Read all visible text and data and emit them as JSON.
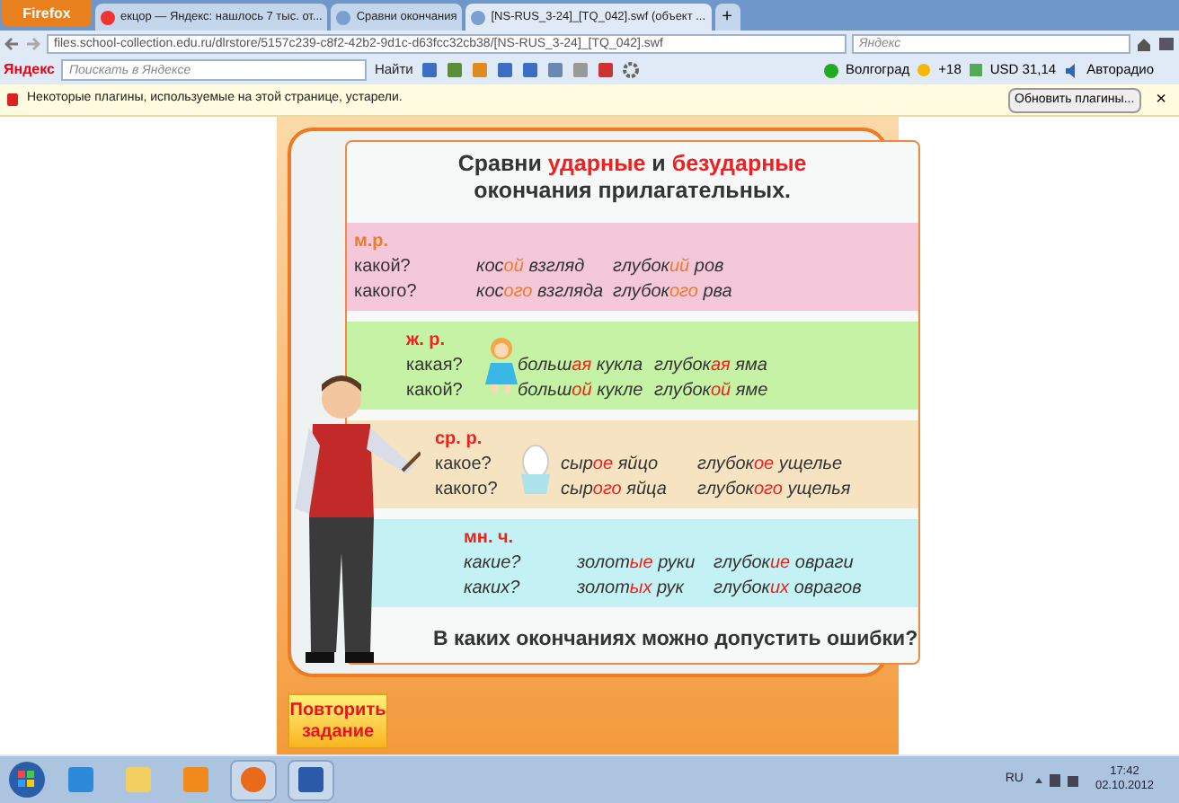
{
  "browser": {
    "app_button": "Firefox",
    "tabs": [
      {
        "label": "екцор — Яндекс: нашлось 7 тыс. от...",
        "selected": false
      },
      {
        "label": "Сравни окончания",
        "selected": false
      },
      {
        "label": "[NS-RUS_3-24]_[TQ_042].swf (объект ...",
        "selected": true
      }
    ],
    "new_tab": "+",
    "url": "files.school-collection.edu.ru/dlrstore/5157c239-c8f2-42b2-9d1c-d63fcc32cb38/[NS-RUS_3-24]_[TQ_042].swf",
    "search_placeholder": "Яндекс"
  },
  "toolbar": {
    "logo": "Яндекс",
    "search_placeholder": "Поискать в Яндексе",
    "find": "Найти",
    "city": "Волгоград",
    "weather": "+18",
    "currency": "USD 31,14",
    "radio": "Авторадио"
  },
  "notification": {
    "text": "Некоторые плагины, используемые на этой странице, устарели.",
    "button": "Обновить плагины...",
    "close": "×"
  },
  "exercise": {
    "title": [
      {
        "text": "Сравни ",
        "accent": false
      },
      {
        "text": "ударные",
        "accent": true
      },
      {
        "text": " и ",
        "accent": false
      },
      {
        "text": "безударные",
        "accent": true
      }
    ],
    "subtitle": "окончания прилагательных.",
    "sections": [
      {
        "label": {
          "text": "м.р.",
          "color": "#f07a2a"
        },
        "color": "#f4c7d9",
        "questions_italic": false,
        "rows": [
          {
            "question": "какой?",
            "phrases": [
              [
                "кос",
                "ой",
                " взгляд"
              ],
              [
                "глубок",
                "ий",
                " ров"
              ]
            ]
          },
          {
            "question": "какого?",
            "phrases": [
              [
                "кос",
                "ого",
                " взгляда"
              ],
              [
                "глубок",
                "ого",
                " рва"
              ]
            ]
          }
        ]
      },
      {
        "label": {
          "text": "ж. р.",
          "color": "#f0201c"
        },
        "color": "#c5f2a4",
        "questions_italic": false,
        "rows": [
          {
            "question": "какая?",
            "phrases": [
              [
                "больш",
                "ая",
                " кукла"
              ],
              [
                "глубок",
                "ая",
                " яма"
              ]
            ]
          },
          {
            "question": "какой?",
            "phrases": [
              [
                "больш",
                "ой",
                " кукле"
              ],
              [
                "глубок",
                "ой",
                " яме"
              ]
            ]
          }
        ]
      },
      {
        "label": {
          "text": "ср. р.",
          "color": "#f0201c"
        },
        "color": "#f6e3c2",
        "questions_italic": false,
        "rows": [
          {
            "question": "какое?",
            "phrases": [
              [
                "сыр",
                "ое",
                " яйцо"
              ],
              [
                "глубок",
                "ое",
                " ущелье"
              ]
            ]
          },
          {
            "question": "какого?",
            "phrases": [
              [
                "сыр",
                "ого",
                " яйца"
              ],
              [
                "глубок",
                "ого",
                " ущелья"
              ]
            ]
          }
        ]
      },
      {
        "label": {
          "text": "мн. ч.",
          "color": "#f0201c"
        },
        "color": "#c4f1f3",
        "questions_italic": true,
        "rows": [
          {
            "question": "какие?",
            "phrases": [
              [
                "золот",
                "ые",
                " руки"
              ],
              [
                "глубок",
                "ие",
                " овраги"
              ]
            ]
          },
          {
            "question": "каких?",
            "phrases": [
              [
                "золот",
                "ых",
                " рук"
              ],
              [
                "глубок",
                "их",
                " оврагов"
              ]
            ]
          }
        ]
      }
    ],
    "question": "В каких окончаниях можно допустить ошибки?",
    "repeat_button": "Повторить задание"
  },
  "taskbar": {
    "language": "RU",
    "time": "17:42",
    "date": "02.10.2012"
  }
}
